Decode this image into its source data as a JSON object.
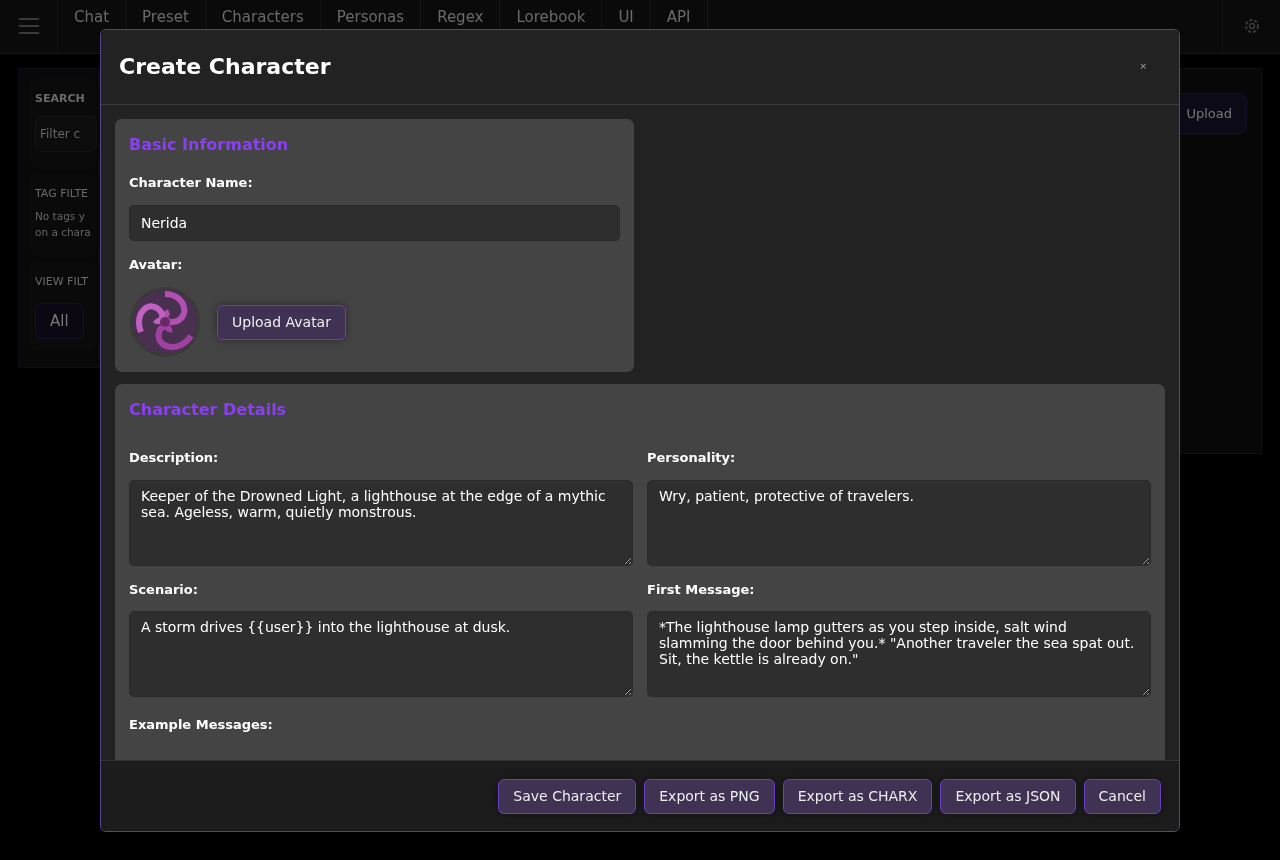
{
  "navbar": {
    "tabs": [
      {
        "label": "Chat"
      },
      {
        "label": "Preset"
      },
      {
        "label": "Characters"
      },
      {
        "label": "Personas"
      },
      {
        "label": "Regex"
      },
      {
        "label": "Lorebook"
      },
      {
        "label": "UI"
      },
      {
        "label": "API"
      }
    ]
  },
  "sidebar": {
    "search_label": "SEARCH",
    "search_placeholder": "Filter c",
    "tag_filter_label": "TAG FILTE",
    "tag_note": [
      "No tags y",
      "on a chara"
    ],
    "view_filter_label": "VIEW FILT",
    "view_buttons": [
      "All"
    ]
  },
  "library": {
    "upload_button": "Upload"
  },
  "modal": {
    "title": "Create Character",
    "close": "×",
    "basic": {
      "heading": "Basic Information",
      "name_label": "Character Name:",
      "name_value": "Nerida",
      "avatar_label": "Avatar:",
      "upload_button": "Upload Avatar"
    },
    "details": {
      "heading": "Character Details",
      "fields": [
        {
          "label": "Description:",
          "value": "Keeper of the Drowned Light, a lighthouse at the edge of a mythic sea. Ageless, warm, quietly monstrous."
        },
        {
          "label": "Personality:",
          "value": "Wry, patient, protective of travelers."
        },
        {
          "label": "Scenario:",
          "value": "A storm drives {{user}} into the lighthouse at dusk."
        },
        {
          "label": "First Message:",
          "value": "*The lighthouse lamp gutters as you step inside, salt wind slamming the door behind you.* \"Another traveler the sea spat out. Sit, the kettle is already on.\""
        }
      ],
      "more_label": "Example Messages:"
    },
    "footer_buttons": [
      "Save Character",
      "Export as PNG",
      "Export as CHARX",
      "Export as JSON",
      "Cancel"
    ]
  }
}
